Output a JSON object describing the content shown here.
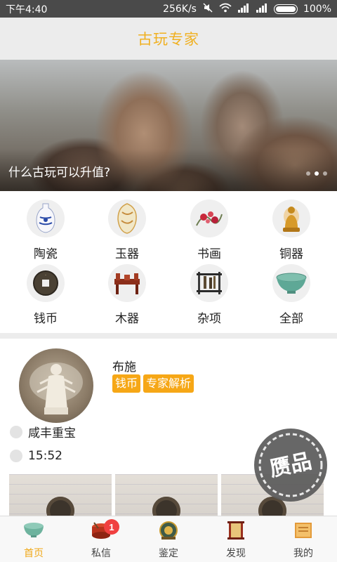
{
  "status_bar": {
    "time": "下午4:40",
    "speed": "256K/s",
    "battery": "100%"
  },
  "header": {
    "title": "古玩专家"
  },
  "banner": {
    "caption": "什么古玩可以升值?",
    "page_count": 3,
    "active_page": 1
  },
  "categories": [
    {
      "label": "陶瓷",
      "icon": "blue-white-vase-icon"
    },
    {
      "label": "玉器",
      "icon": "jade-icon"
    },
    {
      "label": "书画",
      "icon": "painting-icon"
    },
    {
      "label": "铜器",
      "icon": "bronze-buddha-icon"
    },
    {
      "label": "钱币",
      "icon": "coin-icon"
    },
    {
      "label": "木器",
      "icon": "wooden-furniture-icon"
    },
    {
      "label": "杂项",
      "icon": "misc-rack-icon"
    },
    {
      "label": "全部",
      "icon": "celadon-bowl-icon"
    }
  ],
  "post": {
    "title": "布施",
    "tags": [
      "钱币",
      "专家解析"
    ],
    "name": "咸丰重宝",
    "time": "15:52",
    "stamp_text": "赝品"
  },
  "bottom_nav": {
    "items": [
      {
        "label": "首页",
        "icon": "home-bowl-icon",
        "active": true
      },
      {
        "label": "私信",
        "icon": "message-drum-icon",
        "badge": "1"
      },
      {
        "label": "鉴定",
        "icon": "appraise-compass-icon"
      },
      {
        "label": "发现",
        "icon": "discover-scroll-icon"
      },
      {
        "label": "我的",
        "icon": "profile-book-icon"
      }
    ]
  },
  "colors": {
    "accent": "#f0a818",
    "tag_bg": "#f6a716",
    "badge": "#f04040",
    "status_bar": "#4a4a4a",
    "header_bg": "#ececec"
  }
}
